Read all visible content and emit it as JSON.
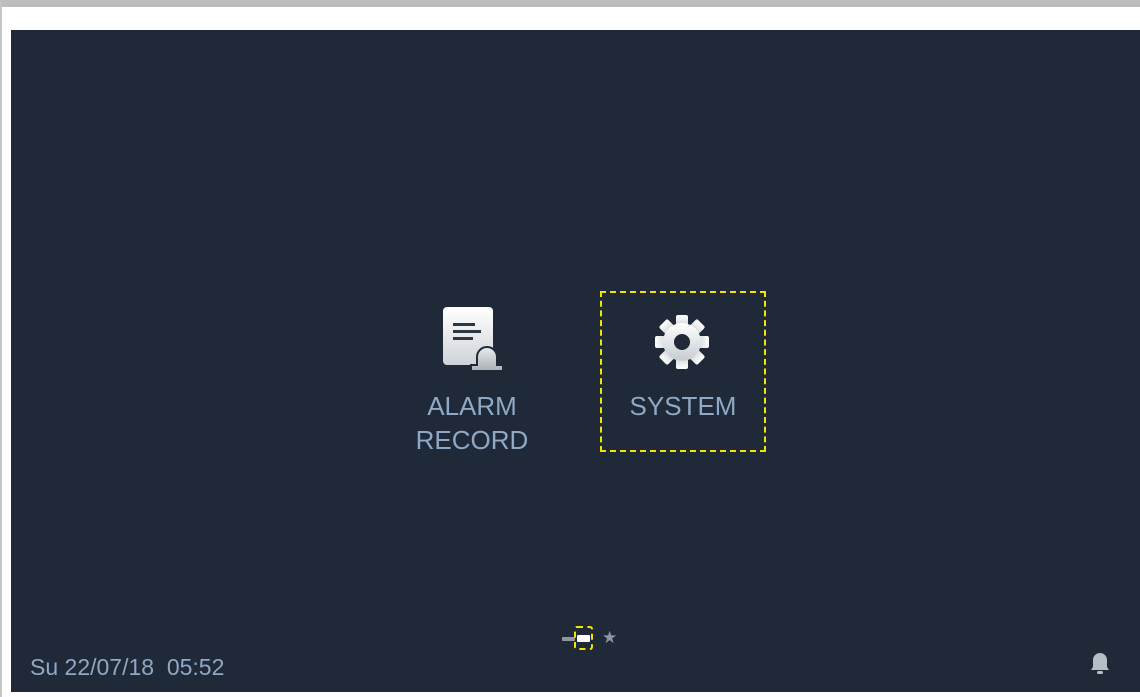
{
  "menu": {
    "items": [
      {
        "id": "alarm_record",
        "label_line1": "ALARM",
        "label_line2": "RECORD",
        "icon": "alarm-record-icon"
      },
      {
        "id": "system",
        "label": "SYSTEM",
        "icon": "gear-icon",
        "focused": true
      }
    ]
  },
  "pagination": {
    "page_count": 3,
    "current_page": 2,
    "last_page_icon": "star-icon"
  },
  "status_bar": {
    "datetime": "Su 22/07/18  05:52",
    "right_icon": "bell-icon"
  },
  "colors": {
    "background": "#1f2937",
    "label": "#8fa8c5",
    "focus_outline": "#f2e600",
    "icon_light": "#ffffff",
    "icon_muted": "#8b96a6"
  }
}
